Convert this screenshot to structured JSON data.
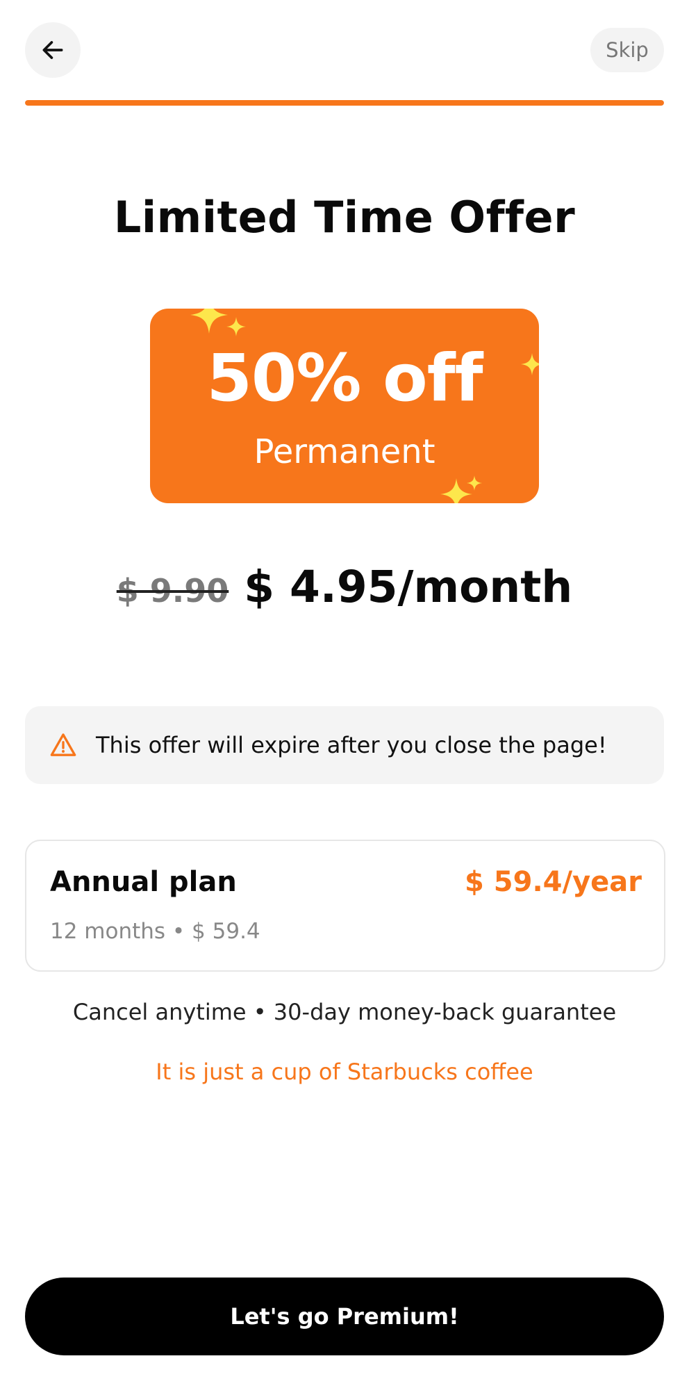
{
  "header": {
    "back_icon": "arrow-left-icon",
    "skip_label": "Skip"
  },
  "progress": {
    "value": 1.0,
    "color": "#f7761b"
  },
  "title": "Limited Time Offer",
  "offer": {
    "discount": "50% off",
    "term": "Permanent",
    "background": "#f7761b",
    "sparkle_color": "#fde74c",
    "sparkle_icon": "sparkle-icon"
  },
  "pricing": {
    "old_price": "$ 9.90",
    "new_price": "$ 4.95/month"
  },
  "warning": {
    "icon": "warning-triangle-icon",
    "text": "This offer will expire after you close the page!"
  },
  "plan": {
    "name": "Annual plan",
    "price": "$ 59.4/year",
    "detail": "12 months • $ 59.4"
  },
  "guarantee": "Cancel anytime • 30-day money-back guarantee",
  "tagline": "It is just a cup of Starbucks coffee",
  "cta_label": "Let's go Premium!",
  "colors": {
    "accent": "#f7761b",
    "cta_background": "#000000",
    "surface": "#f4f4f4"
  }
}
